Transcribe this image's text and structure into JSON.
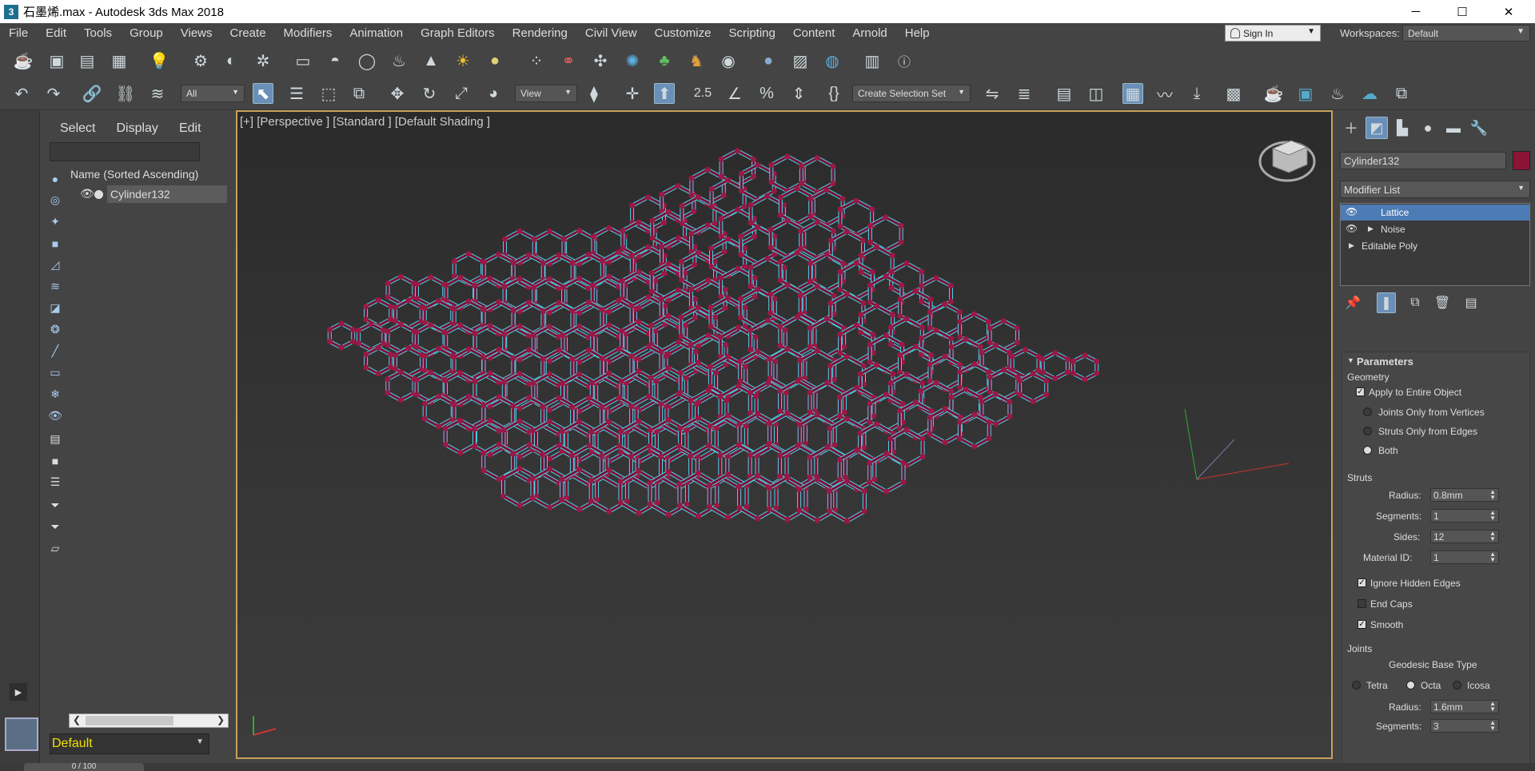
{
  "window": {
    "title": "石墨烯.max - Autodesk 3ds Max 2018",
    "app_icon": "3",
    "minimize": "─",
    "maximize": "☐",
    "close": "✕"
  },
  "menu": [
    "File",
    "Edit",
    "Tools",
    "Group",
    "Views",
    "Create",
    "Modifiers",
    "Animation",
    "Graph Editors",
    "Rendering",
    "Civil View",
    "Customize",
    "Scripting",
    "Content",
    "Arnold",
    "Help"
  ],
  "account": {
    "signin": "Sign In",
    "workspaces_label": "Workspaces:",
    "workspace": "Default"
  },
  "toolbar": {
    "filter": "All",
    "refcoord": "View",
    "snap_label": "2.5",
    "selection_set": "Create Selection Set"
  },
  "scene_explorer": {
    "tabs": [
      "Select",
      "Display",
      "Edit"
    ],
    "column_header": "Name (Sorted Ascending)",
    "rows": [
      {
        "name": "Cylinder132"
      }
    ],
    "layer": "Default"
  },
  "viewport": {
    "label": "[+] [Perspective ] [Standard ] [Default Shading ]"
  },
  "command_panel": {
    "object_name": "Cylinder132",
    "object_color": "#8c1236",
    "modifier_list": "Modifier List",
    "stack": [
      {
        "label": "Lattice",
        "selected": true
      },
      {
        "label": "Noise",
        "selected": false
      },
      {
        "label": "Editable Poly",
        "selected": false
      }
    ],
    "parameters": {
      "title": "Parameters",
      "geometry": {
        "heading": "Geometry",
        "apply_entire": "Apply to Entire Object",
        "opt_joints": "Joints Only from Vertices",
        "opt_struts": "Struts Only from Edges",
        "opt_both": "Both"
      },
      "struts": {
        "heading": "Struts",
        "radius_label": "Radius:",
        "radius": "0.8mm",
        "segments_label": "Segments:",
        "segments": "1",
        "sides_label": "Sides:",
        "sides": "12",
        "matid_label": "Material ID:",
        "matid": "1",
        "ignore_hidden": "Ignore Hidden Edges",
        "end_caps": "End Caps",
        "smooth": "Smooth"
      },
      "joints": {
        "heading": "Joints",
        "geo_base": "Geodesic Base Type",
        "tetra": "Tetra",
        "octa": "Octa",
        "icosa": "Icosa",
        "radius_label": "Radius:",
        "radius": "1.6mm",
        "segments_label": "Segments:",
        "segments": "3"
      }
    }
  },
  "colors": {
    "lattice_strut": "#7a1035",
    "lattice_joint": "#9a1845",
    "selection_outline": "#46d6e8",
    "annotation_arrow": "#d9312b"
  },
  "timeline": {
    "frame": "0 / 100"
  }
}
